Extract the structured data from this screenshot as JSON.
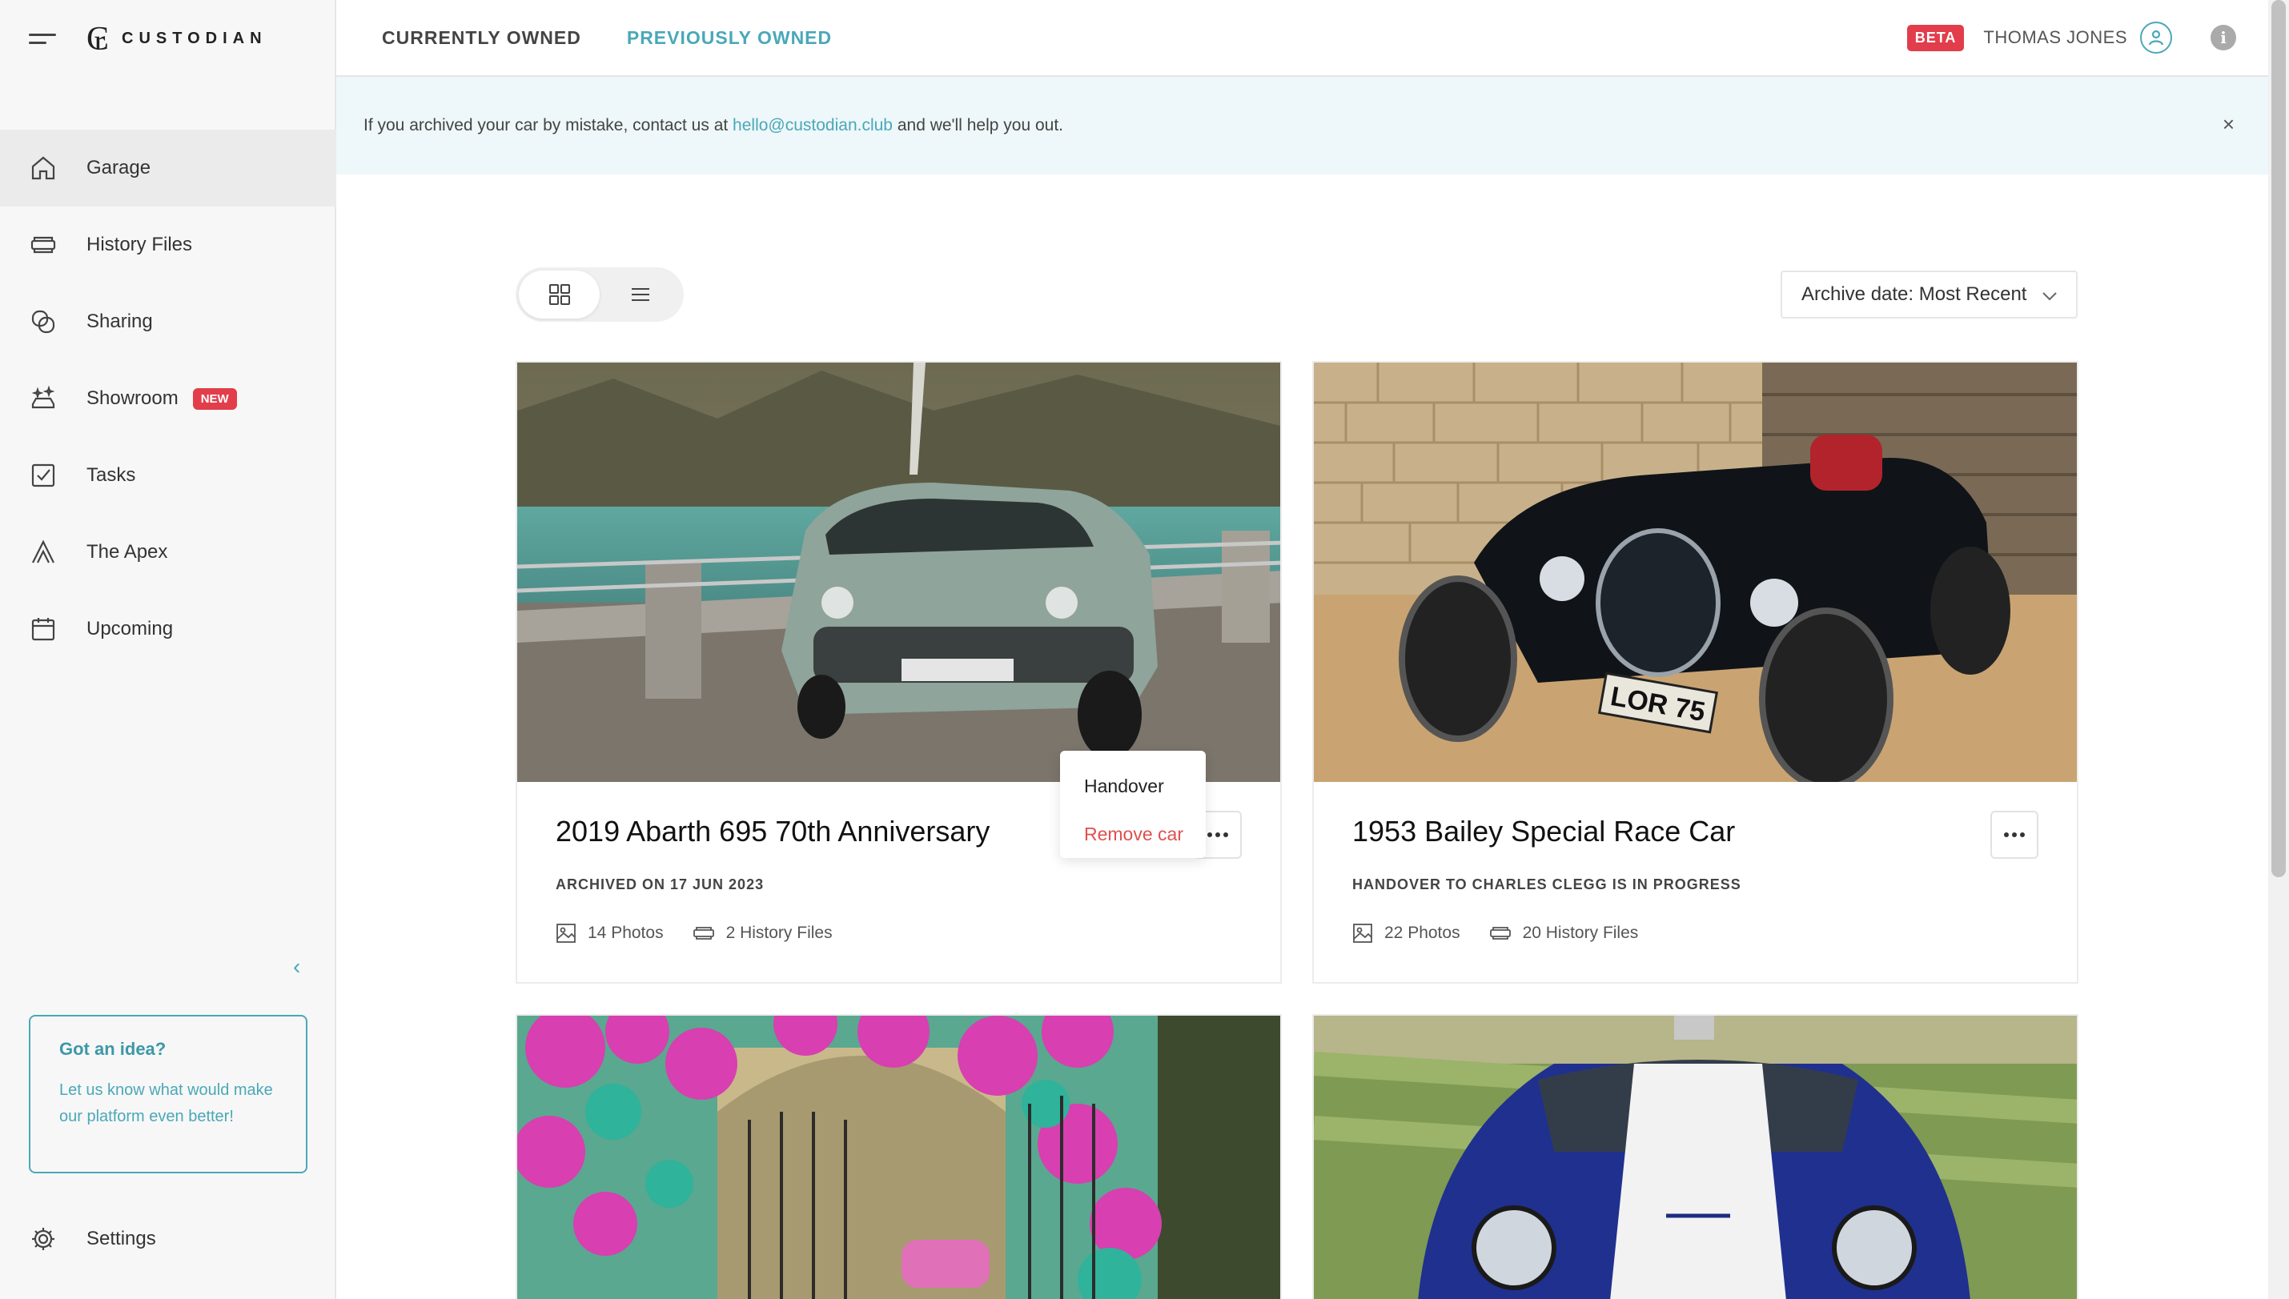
{
  "brand": {
    "name": "CUSTODIAN"
  },
  "sidebar": {
    "items": [
      {
        "label": "Garage",
        "icon": "home-icon",
        "active": true
      },
      {
        "label": "History Files",
        "icon": "files-icon"
      },
      {
        "label": "Sharing",
        "icon": "share-icon"
      },
      {
        "label": "Showroom",
        "icon": "showroom-icon",
        "badge": "NEW"
      },
      {
        "label": "Tasks",
        "icon": "tasks-icon"
      },
      {
        "label": "The Apex",
        "icon": "apex-icon"
      },
      {
        "label": "Upcoming",
        "icon": "calendar-icon"
      }
    ],
    "idea": {
      "title": "Got an idea?",
      "text": "Let us know what would make our platform even better!"
    },
    "settings_label": "Settings"
  },
  "topbar": {
    "tabs": [
      {
        "label": "CURRENTLY OWNED",
        "active": false
      },
      {
        "label": "PREVIOUSLY OWNED",
        "active": true
      }
    ],
    "beta": "BETA",
    "user": "THOMAS JONES"
  },
  "banner": {
    "prefix": "If you archived your car by mistake, contact us at ",
    "email": "hello@custodian.club",
    "suffix": " and we'll help you out.",
    "close": "×"
  },
  "toolbar": {
    "sort": "Archive date: Most Recent"
  },
  "cars": [
    {
      "title": "2019 Abarth 695 70th Anniversary",
      "status": "ARCHIVED ON 17 JUN 2023",
      "photos": "14 Photos",
      "history": "2 History Files"
    },
    {
      "title": "1953 Bailey Special Race Car",
      "status": "HANDOVER TO CHARLES CLEGG IS IN PROGRESS",
      "photos": "22 Photos",
      "history": "20 History Files"
    }
  ],
  "menu": {
    "handover": "Handover",
    "remove": "Remove car"
  },
  "colors": {
    "accent": "#4aa8b8",
    "danger": "#e23d4b",
    "banner_bg": "#eef7f9"
  }
}
